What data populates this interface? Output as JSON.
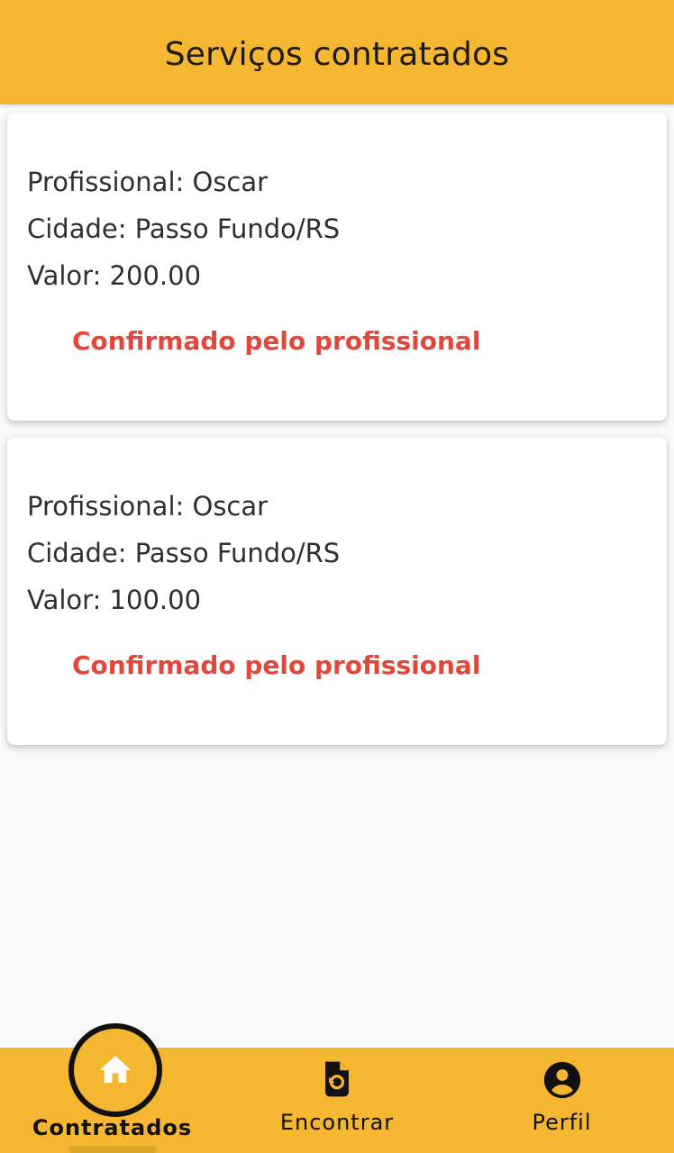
{
  "header": {
    "title": "Serviços contratados"
  },
  "services": [
    {
      "professional": "Profissional: Oscar",
      "city": "Cidade: Passo Fundo/RS",
      "value": "Valor: 200.00",
      "status": "Confirmado pelo profissional"
    },
    {
      "professional": "Profissional: Oscar",
      "city": "Cidade: Passo Fundo/RS",
      "value": "Valor: 100.00",
      "status": "Confirmado pelo profissional"
    }
  ],
  "bottom_nav": {
    "items": [
      {
        "label": "Contratados",
        "icon": "home-icon",
        "selected": true
      },
      {
        "label": "Encontrar",
        "icon": "find-document-icon",
        "selected": false
      },
      {
        "label": "Perfil",
        "icon": "account-circle-icon",
        "selected": false
      }
    ]
  },
  "colors": {
    "accent": "#f5b731",
    "status": "#e2473a",
    "background": "#fafafa",
    "card": "#ffffff",
    "text": "#2f2f2f"
  }
}
